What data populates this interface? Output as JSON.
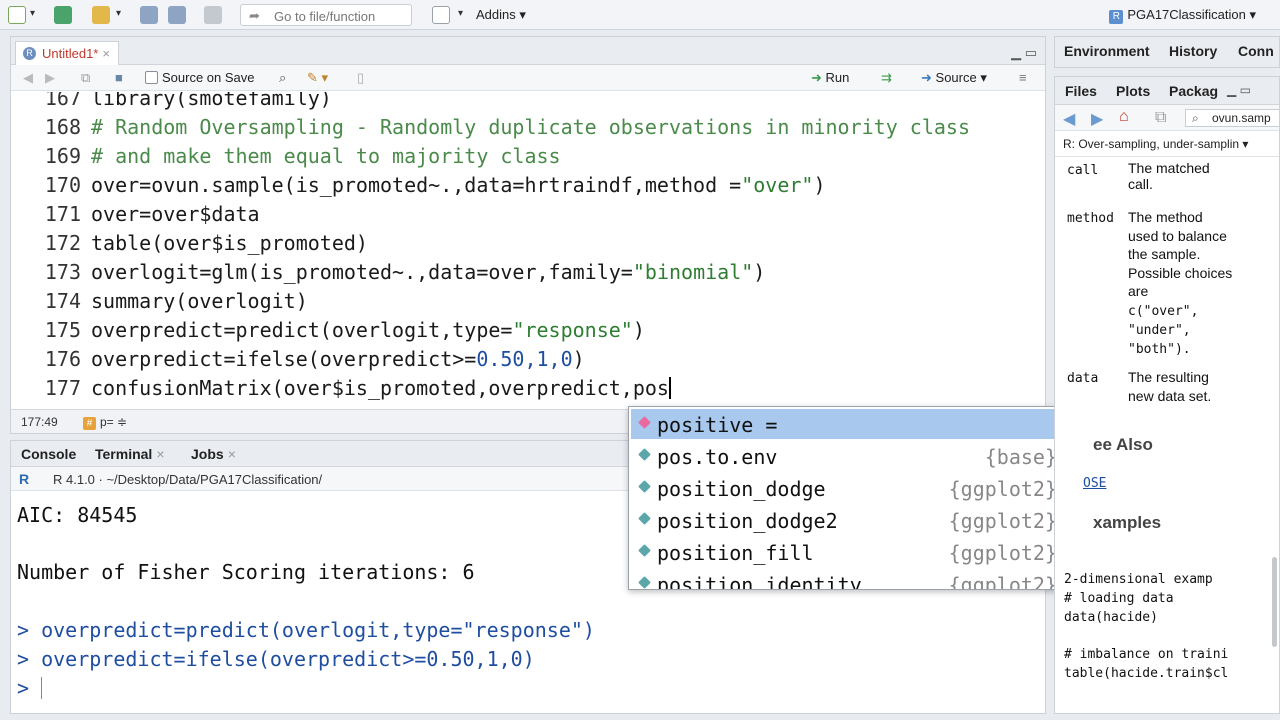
{
  "toolbar": {
    "goto_placeholder": "Go to file/function",
    "addins": "Addins",
    "project": "PGA17Classification"
  },
  "editor": {
    "tab": "Untitled1*",
    "source_on_save": "Source on Save",
    "run": "Run",
    "source": "Source",
    "lines": [
      {
        "n": "167",
        "t": "library(smotefamily)"
      },
      {
        "n": "168",
        "t": "# Random Oversampling - Randomly duplicate observations in minority class"
      },
      {
        "n": "169",
        "t": "# and make them equal to majority class"
      },
      {
        "n": "170",
        "a": "over=ovun.sample(is_promoted~.,data=hrtraindf,method =",
        "s": "\"over\"",
        "b": ")"
      },
      {
        "n": "171",
        "t": "over=over$data"
      },
      {
        "n": "172",
        "t": "table(over$is_promoted)"
      },
      {
        "n": "173",
        "a": "overlogit=glm(is_promoted~.,data=over,family=",
        "s": "\"binomial\"",
        "b": ")"
      },
      {
        "n": "174",
        "t": "summary(overlogit)"
      },
      {
        "n": "175",
        "a": "overpredict=predict(overlogit,type=",
        "s": "\"response\"",
        "b": ")"
      },
      {
        "n": "176",
        "a": "overpredict=ifelse(overpredict>=",
        "s": "0.50,1,0",
        "b": ")"
      },
      {
        "n": "177",
        "t": "confusionMatrix(over$is_promoted,overpredict,pos"
      }
    ],
    "status_pos": "177:49",
    "status_fn": "p= ≑"
  },
  "autocomplete": [
    {
      "name": "positive =",
      "pkg": ""
    },
    {
      "name": "pos.to.env",
      "pkg": "{base}"
    },
    {
      "name": "position_dodge",
      "pkg": "{ggplot2}"
    },
    {
      "name": "position_dodge2",
      "pkg": "{ggplot2}"
    },
    {
      "name": "position_fill",
      "pkg": "{ggplot2}"
    },
    {
      "name": "position_identity",
      "pkg": "{ggplot2}"
    }
  ],
  "console": {
    "tabs": [
      "Console",
      "Terminal",
      "Jobs"
    ],
    "path": "R 4.1.0 · ~/Desktop/Data/PGA17Classification/",
    "lines": [
      "AIC: 84545",
      "",
      "Number of Fisher Scoring iterations: 6",
      "",
      "> overpredict=predict(overlogit,type=\"response\")",
      "> overpredict=ifelse(overpredict>=0.50,1,0)",
      ">"
    ]
  },
  "env_tabs": [
    "Environment",
    "History",
    "Conn"
  ],
  "help": {
    "tabs": [
      "Files",
      "Plots",
      "Packag"
    ],
    "search": "ovun.samp",
    "topic": "R: Over-sampling, under-samplin",
    "args": [
      {
        "name": "call",
        "desc": "The matched\ncall."
      },
      {
        "name": "method",
        "desc": "The method\nused to balance\nthe sample.\nPossible choices\nare"
      },
      {
        "name": "data",
        "desc": "The resulting\nnew data set."
      }
    ],
    "method_choices": "c(\"over\",\n\"under\",\n\"both\").",
    "see_also": "ee Also",
    "see_link": "OSE",
    "examples": "xamples",
    "example_code": "2-dimensional examp\n# loading data\ndata(hacide)\n\n# imbalance on traini\ntable(hacide.train$cl"
  }
}
